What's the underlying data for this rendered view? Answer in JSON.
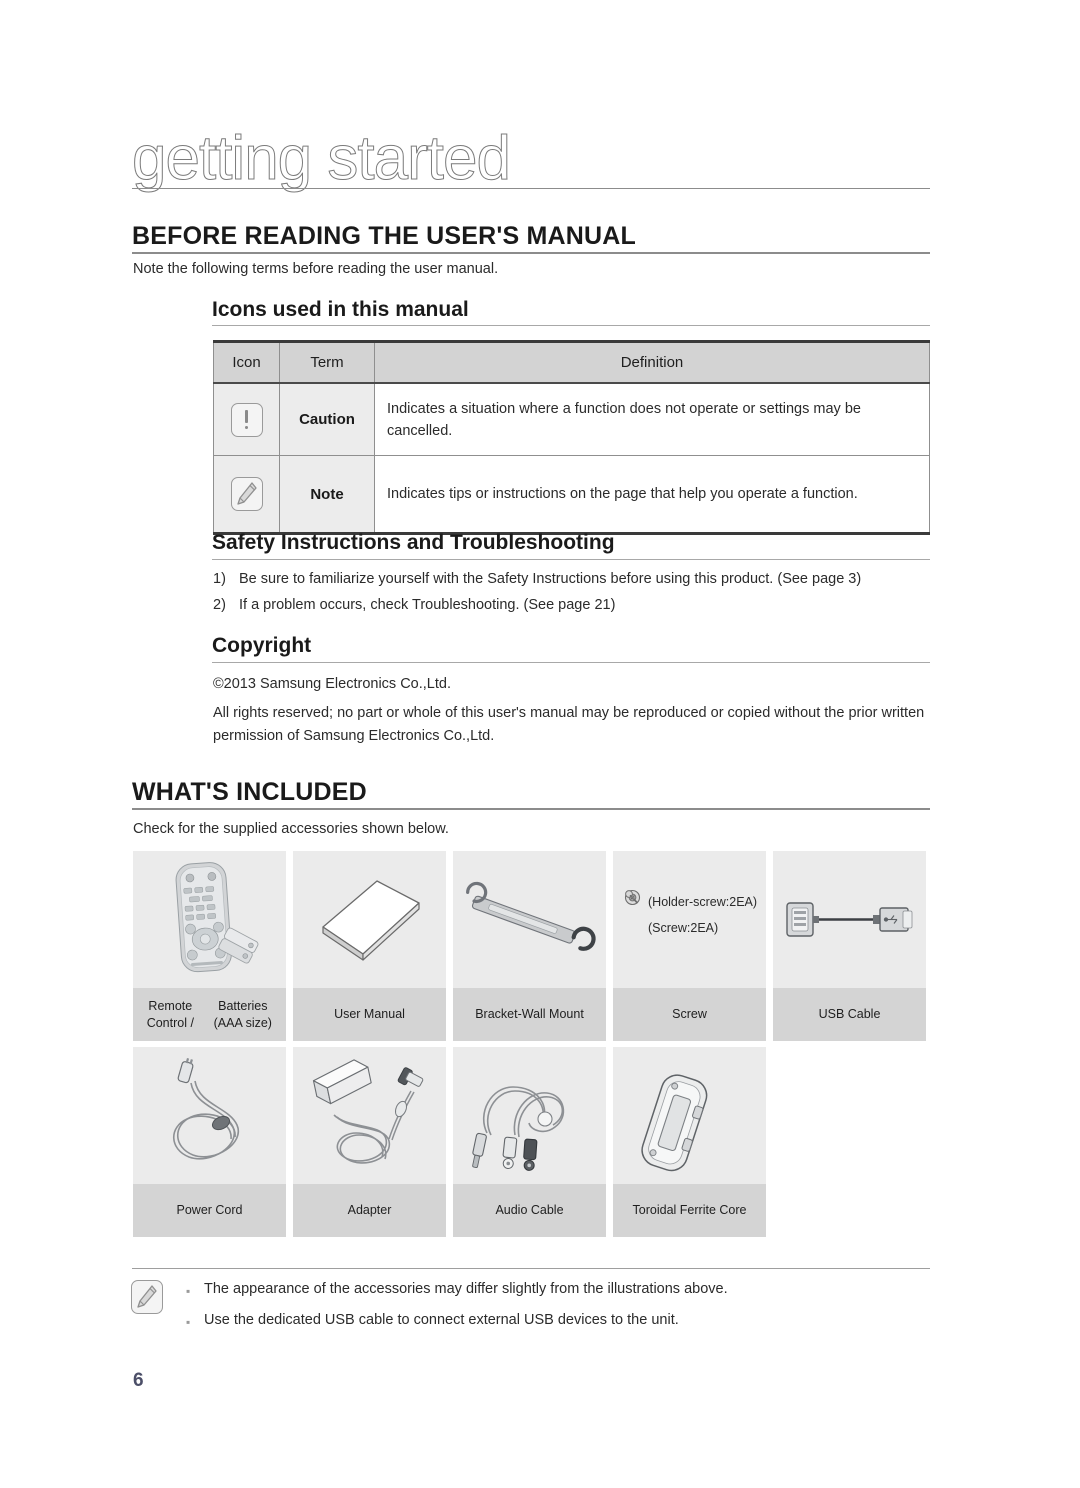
{
  "chapter": {
    "title": "getting started"
  },
  "sections": {
    "before_reading": {
      "heading": "BEFORE READING THE USER'S MANUAL",
      "intro": "Note the following terms before reading the user manual.",
      "icons_subheading": "Icons used in this manual",
      "table": {
        "headers": [
          "Icon",
          "Term",
          "Definition"
        ],
        "rows": [
          {
            "icon": "caution-icon",
            "term": "Caution",
            "definition": "Indicates a situation where a function does not operate or settings may be cancelled."
          },
          {
            "icon": "note-icon",
            "term": "Note",
            "definition": "Indicates tips or instructions on the page that help you operate a function."
          }
        ]
      },
      "safety_subheading": "Safety Instructions and Troubleshooting",
      "safety_items": [
        {
          "number": "1)",
          "text": "Be sure to familiarize yourself with the Safety Instructions before using this product. (See page 3)"
        },
        {
          "number": "2)",
          "text": "If a problem occurs, check Troubleshooting. (See page 21)"
        }
      ],
      "copyright_subheading": "Copyright",
      "copyright_line": "©2013 Samsung Electronics Co.,Ltd.",
      "copyright_body": "All rights reserved; no part or whole of this user's manual may be reproduced or copied without the prior written permission of Samsung Electronics Co.,Ltd."
    },
    "whats_included": {
      "heading": "WHAT'S INCLUDED",
      "intro": "Check for the supplied accessories shown below.",
      "row1": [
        {
          "label": "Remote Control /\nBatteries (AAA size)",
          "icon": "remote-control-illustration"
        },
        {
          "label": "User Manual",
          "icon": "user-manual-illustration"
        },
        {
          "label": "Bracket-Wall Mount",
          "icon": "bracket-wall-mount-illustration"
        },
        {
          "label": "Screw",
          "icon": "screw-illustration"
        },
        {
          "label": "USB Cable",
          "icon": "usb-cable-illustration"
        }
      ],
      "row2": [
        {
          "label": "Power Cord",
          "icon": "power-cord-illustration"
        },
        {
          "label": "Adapter",
          "icon": "adapter-illustration"
        },
        {
          "label": "Audio Cable",
          "icon": "audio-cable-illustration"
        },
        {
          "label": "Toroidal Ferrite Core",
          "icon": "toroidal-ferrite-core-illustration"
        }
      ],
      "screw_annotations": [
        {
          "icon": "holder-screw-icon",
          "text": "(Holder-screw:2EA)"
        },
        {
          "icon": "screw-icon",
          "text": "(Screw:2EA)"
        }
      ],
      "notes": [
        "The appearance of the accessories may differ slightly from the illustrations above.",
        "Use the dedicated USB cable to connect external USB devices to the unit."
      ]
    }
  },
  "footer": {
    "page_number": "6"
  },
  "colors": {
    "page_number": "#4c4f68",
    "table_header_bg": "#d3d3d3",
    "cell_bg": "#ececec",
    "accessory_image_bg": "#ebebeb",
    "accessory_label_bg": "#d4d4d4"
  }
}
